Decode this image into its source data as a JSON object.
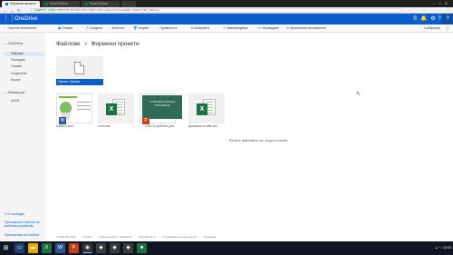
{
  "browser": {
    "tabs": [
      "Фирмени проекти",
      "Excel Online",
      "Excel Online",
      ""
    ],
    "url_secure": "Защитено | https://",
    "url_rest": "onedrive.live.com/?id=7B0BF7E8F2C86CE2%2125&cid=7B0BF7E8F2C86CE2"
  },
  "header": {
    "app_name": "OneDrive",
    "avatar_initial": "?"
  },
  "commandbar": {
    "search_placeholder": "Търсене във всички",
    "commands": [
      "Отваря",
      "Сподели",
      "Изтегли",
      "Изтрий",
      "Премести в",
      "Копирай в",
      "Преименуване",
      "Вграждане",
      "Хронология на версиите"
    ],
    "selected_count": "1 избран(а)"
  },
  "leftnav": {
    "section_onedrive": "OneDrive",
    "items": [
      "Файлове",
      "Последни",
      "Снимки",
      "Споделени",
      "Кошче"
    ],
    "section_computers": "Компютри",
    "computer_items": [
      "ASUS"
    ],
    "storage": "6 ГБ свободни",
    "links": [
      "Приложение OneDrive за мобилни устройства",
      "Приложения за OneDrive"
    ]
  },
  "breadcrumb": {
    "root": "Файлове",
    "current": "Фирмени проекти"
  },
  "folder": {
    "name": "Проект Ураган"
  },
  "files": [
    {
      "name": "Шаблон.docx",
      "type": "doc"
    },
    {
      "name": "отчет.xlsx",
      "type": "xlsx"
    },
    {
      "name": "2018-11-pptNotes.pptx",
      "type": "pptx",
      "slide_text": "С ПРЕЗЕНТАЦИЯ НА ПОКАЗВАНЕ"
    },
    {
      "name": "Диаграма онлайн.xlsx",
      "type": "xlsx"
    }
  ],
  "drop_message": "Пуснете файловете тук, за да ги качите",
  "footer": [
    "© 2018 Microsoft",
    "Условия",
    "Поверителност и бисквитки",
    "Разработчици",
    "Съобщаване за злоупотреба",
    "Български"
  ],
  "taskbar": {
    "clock": "12:03"
  }
}
